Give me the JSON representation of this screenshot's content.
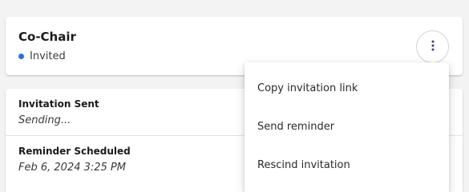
{
  "role": {
    "title": "Co-Chair",
    "status": "Invited",
    "status_color": "#2b6fe0",
    "menu_icon": "more-vertical-icon"
  },
  "details": [
    {
      "label": "Invitation Sent",
      "value": "Sending..."
    },
    {
      "label": "Reminder Scheduled",
      "value": "Feb 6, 2024 3:25 PM"
    }
  ],
  "menu": {
    "items": [
      {
        "label": "Copy invitation link"
      },
      {
        "label": "Send reminder"
      },
      {
        "label": "Rescind invitation"
      }
    ]
  }
}
